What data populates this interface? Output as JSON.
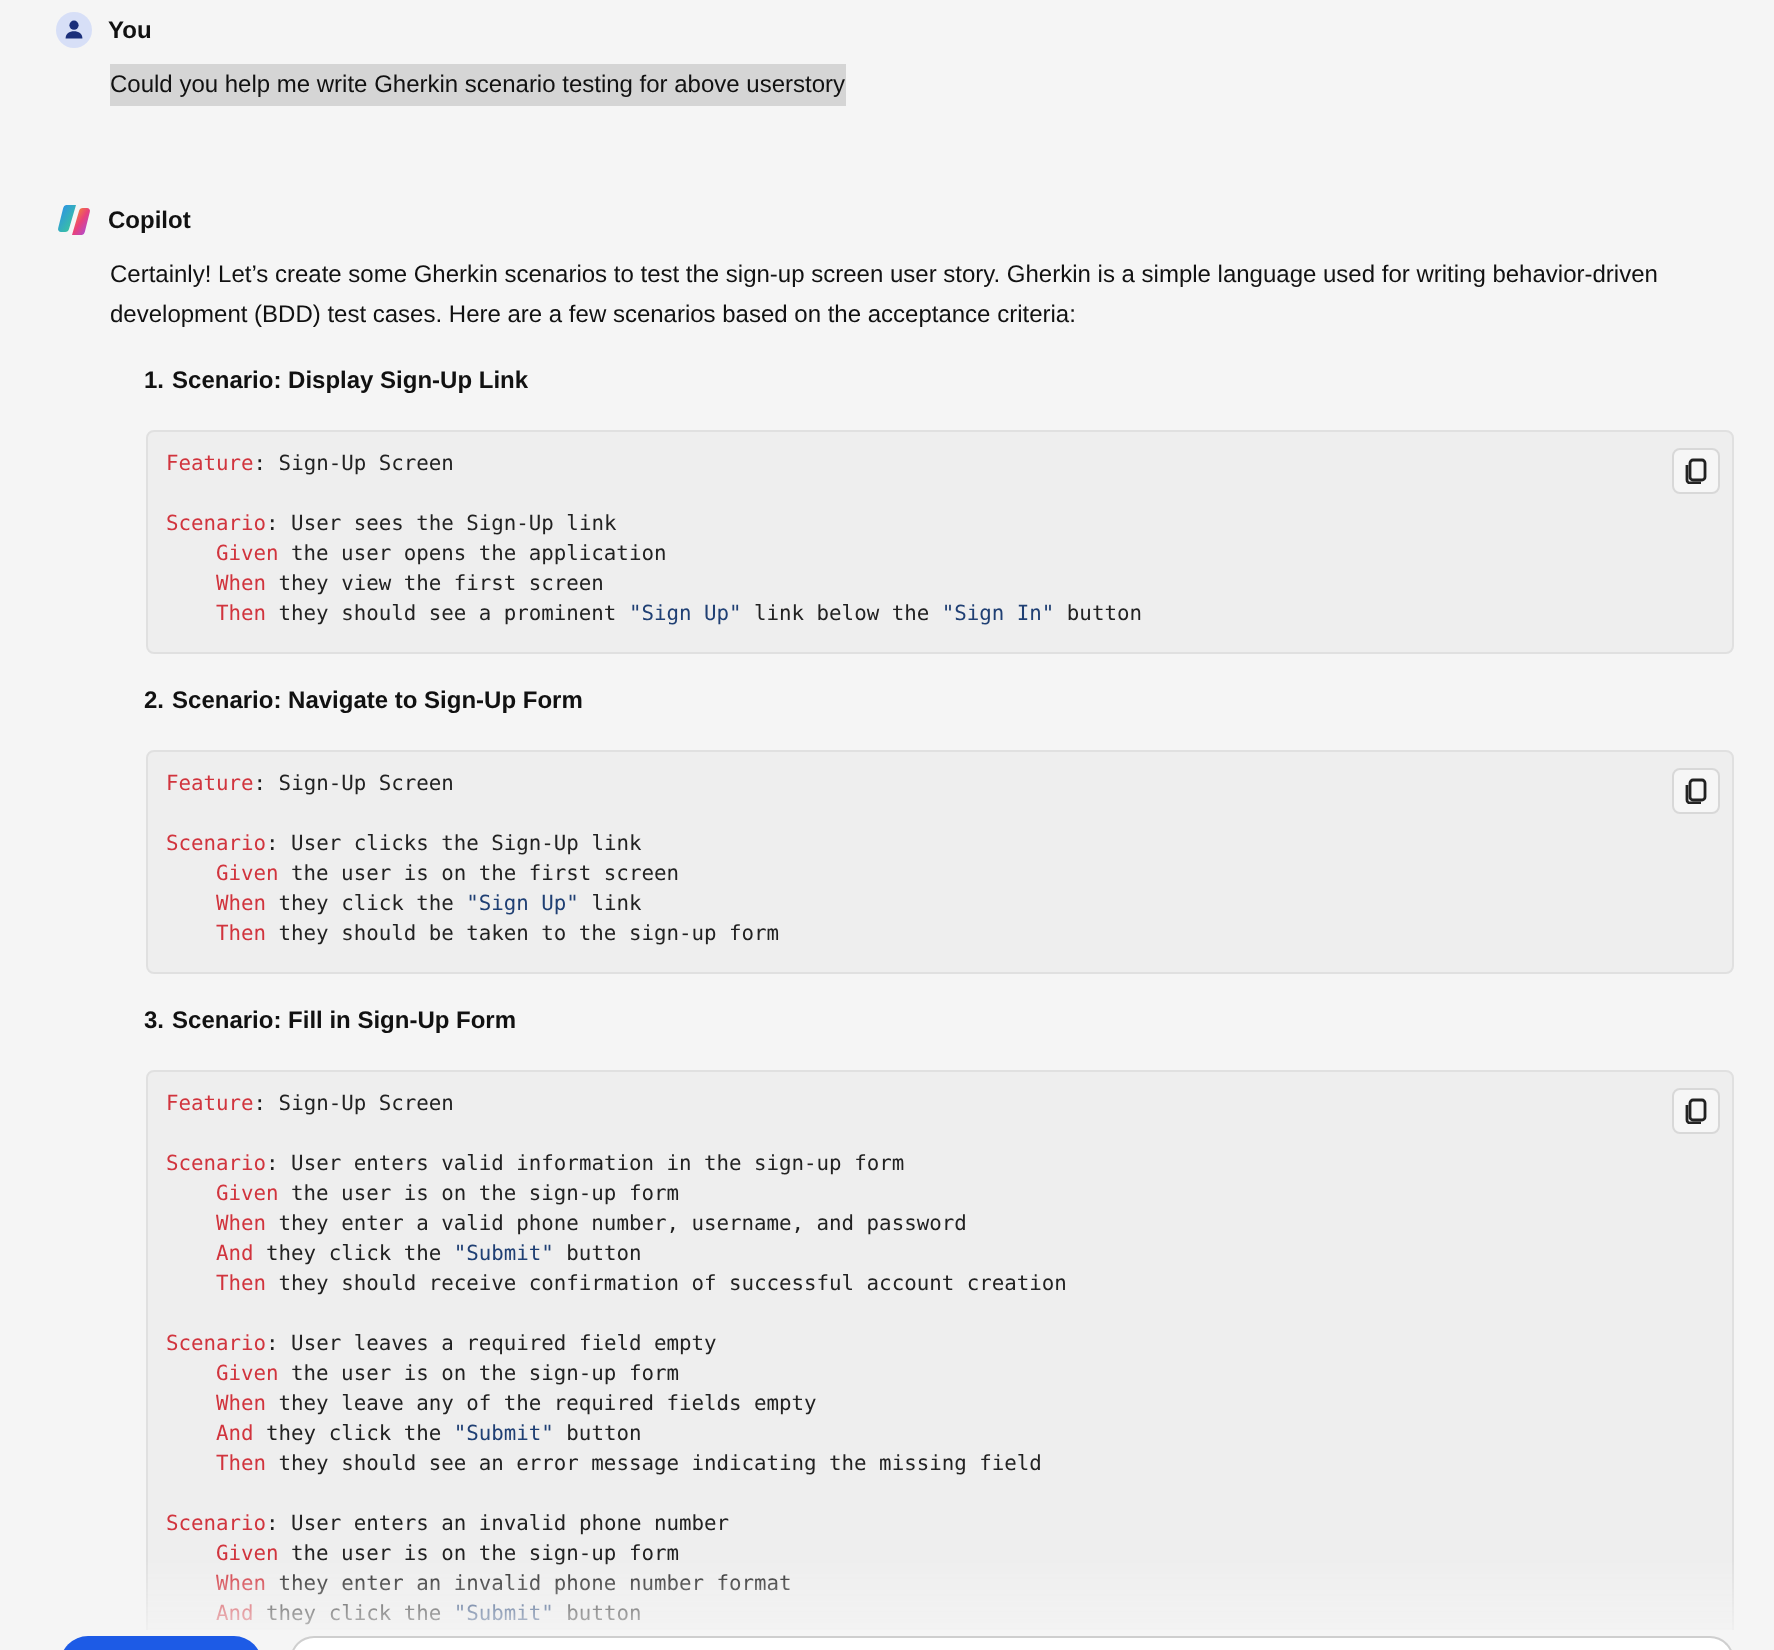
{
  "messages": [
    {
      "author": "You",
      "kind": "user",
      "text": "Could you help me write Gherkin scenario testing for above userstory"
    },
    {
      "author": "Copilot",
      "kind": "assistant",
      "intro": "Certainly! Let’s create some Gherkin scenarios to test the sign-up screen user story. Gherkin is a simple language used for writing behavior-driven development (BDD) test cases. Here are a few scenarios based on the acceptance criteria:",
      "items": [
        {
          "number": "1.",
          "title": "Scenario: Display Sign-Up Link",
          "code": [
            {
              "kind": "header",
              "tokens": [
                {
                  "kind": "keyword",
                  "text": "Feature"
                },
                {
                  "kind": "plain",
                  "text": ": Sign-Up Screen"
                }
              ]
            },
            {
              "kind": "blank"
            },
            {
              "kind": "header",
              "tokens": [
                {
                  "kind": "keyword",
                  "text": "Scenario"
                },
                {
                  "kind": "plain",
                  "text": ": User sees the Sign-Up link"
                }
              ]
            },
            {
              "kind": "step",
              "tokens": [
                {
                  "kind": "keyword",
                  "text": "Given"
                },
                {
                  "kind": "plain",
                  "text": " the user opens the application"
                }
              ]
            },
            {
              "kind": "step",
              "tokens": [
                {
                  "kind": "keyword",
                  "text": "When"
                },
                {
                  "kind": "plain",
                  "text": " they view the first screen"
                }
              ]
            },
            {
              "kind": "step",
              "tokens": [
                {
                  "kind": "keyword",
                  "text": "Then"
                },
                {
                  "kind": "plain",
                  "text": " they should see a prominent "
                },
                {
                  "kind": "string",
                  "text": "\"Sign Up\""
                },
                {
                  "kind": "plain",
                  "text": " link below the "
                },
                {
                  "kind": "string",
                  "text": "\"Sign In\""
                },
                {
                  "kind": "plain",
                  "text": " button"
                }
              ]
            }
          ]
        },
        {
          "number": "2.",
          "title": "Scenario: Navigate to Sign-Up Form",
          "code": [
            {
              "kind": "header",
              "tokens": [
                {
                  "kind": "keyword",
                  "text": "Feature"
                },
                {
                  "kind": "plain",
                  "text": ": Sign-Up Screen"
                }
              ]
            },
            {
              "kind": "blank"
            },
            {
              "kind": "header",
              "tokens": [
                {
                  "kind": "keyword",
                  "text": "Scenario"
                },
                {
                  "kind": "plain",
                  "text": ": User clicks the Sign-Up link"
                }
              ]
            },
            {
              "kind": "step",
              "tokens": [
                {
                  "kind": "keyword",
                  "text": "Given"
                },
                {
                  "kind": "plain",
                  "text": " the user is on the first screen"
                }
              ]
            },
            {
              "kind": "step",
              "tokens": [
                {
                  "kind": "keyword",
                  "text": "When"
                },
                {
                  "kind": "plain",
                  "text": " they click the "
                },
                {
                  "kind": "string",
                  "text": "\"Sign Up\""
                },
                {
                  "kind": "plain",
                  "text": " link"
                }
              ]
            },
            {
              "kind": "step",
              "tokens": [
                {
                  "kind": "keyword",
                  "text": "Then"
                },
                {
                  "kind": "plain",
                  "text": " they should be taken to the sign-up form"
                }
              ]
            }
          ]
        },
        {
          "number": "3.",
          "title": "Scenario: Fill in Sign-Up Form",
          "code": [
            {
              "kind": "header",
              "tokens": [
                {
                  "kind": "keyword",
                  "text": "Feature"
                },
                {
                  "kind": "plain",
                  "text": ": Sign-Up Screen"
                }
              ]
            },
            {
              "kind": "blank"
            },
            {
              "kind": "header",
              "tokens": [
                {
                  "kind": "keyword",
                  "text": "Scenario"
                },
                {
                  "kind": "plain",
                  "text": ": User enters valid information in the sign-up form"
                }
              ]
            },
            {
              "kind": "step",
              "tokens": [
                {
                  "kind": "keyword",
                  "text": "Given"
                },
                {
                  "kind": "plain",
                  "text": " the user is on the sign-up form"
                }
              ]
            },
            {
              "kind": "step",
              "tokens": [
                {
                  "kind": "keyword",
                  "text": "When"
                },
                {
                  "kind": "plain",
                  "text": " they enter a valid phone number, username, and password"
                }
              ]
            },
            {
              "kind": "step",
              "tokens": [
                {
                  "kind": "keyword",
                  "text": "And"
                },
                {
                  "kind": "plain",
                  "text": " they click the "
                },
                {
                  "kind": "string",
                  "text": "\"Submit\""
                },
                {
                  "kind": "plain",
                  "text": " button"
                }
              ]
            },
            {
              "kind": "step",
              "tokens": [
                {
                  "kind": "keyword",
                  "text": "Then"
                },
                {
                  "kind": "plain",
                  "text": " they should receive confirmation of successful account creation"
                }
              ]
            },
            {
              "kind": "blank"
            },
            {
              "kind": "header",
              "tokens": [
                {
                  "kind": "keyword",
                  "text": "Scenario"
                },
                {
                  "kind": "plain",
                  "text": ": User leaves a required field empty"
                }
              ]
            },
            {
              "kind": "step",
              "tokens": [
                {
                  "kind": "keyword",
                  "text": "Given"
                },
                {
                  "kind": "plain",
                  "text": " the user is on the sign-up form"
                }
              ]
            },
            {
              "kind": "step",
              "tokens": [
                {
                  "kind": "keyword",
                  "text": "When"
                },
                {
                  "kind": "plain",
                  "text": " they leave any of the required fields empty"
                }
              ]
            },
            {
              "kind": "step",
              "tokens": [
                {
                  "kind": "keyword",
                  "text": "And"
                },
                {
                  "kind": "plain",
                  "text": " they click the "
                },
                {
                  "kind": "string",
                  "text": "\"Submit\""
                },
                {
                  "kind": "plain",
                  "text": " button"
                }
              ]
            },
            {
              "kind": "step",
              "tokens": [
                {
                  "kind": "keyword",
                  "text": "Then"
                },
                {
                  "kind": "plain",
                  "text": " they should see an error message indicating the missing field"
                }
              ]
            },
            {
              "kind": "blank"
            },
            {
              "kind": "header",
              "tokens": [
                {
                  "kind": "keyword",
                  "text": "Scenario"
                },
                {
                  "kind": "plain",
                  "text": ": User enters an invalid phone number"
                }
              ]
            },
            {
              "kind": "step",
              "tokens": [
                {
                  "kind": "keyword",
                  "text": "Given"
                },
                {
                  "kind": "plain",
                  "text": " the user is on the sign-up form"
                }
              ]
            },
            {
              "kind": "step",
              "tokens": [
                {
                  "kind": "keyword",
                  "text": "When"
                },
                {
                  "kind": "plain",
                  "text": " they enter an invalid phone number format"
                }
              ]
            },
            {
              "kind": "step",
              "tokens": [
                {
                  "kind": "keyword",
                  "text": "And"
                },
                {
                  "kind": "plain",
                  "text": " they click the "
                },
                {
                  "kind": "string",
                  "text": "\"Submit\""
                },
                {
                  "kind": "plain",
                  "text": " button"
                }
              ]
            }
          ]
        }
      ]
    }
  ]
}
